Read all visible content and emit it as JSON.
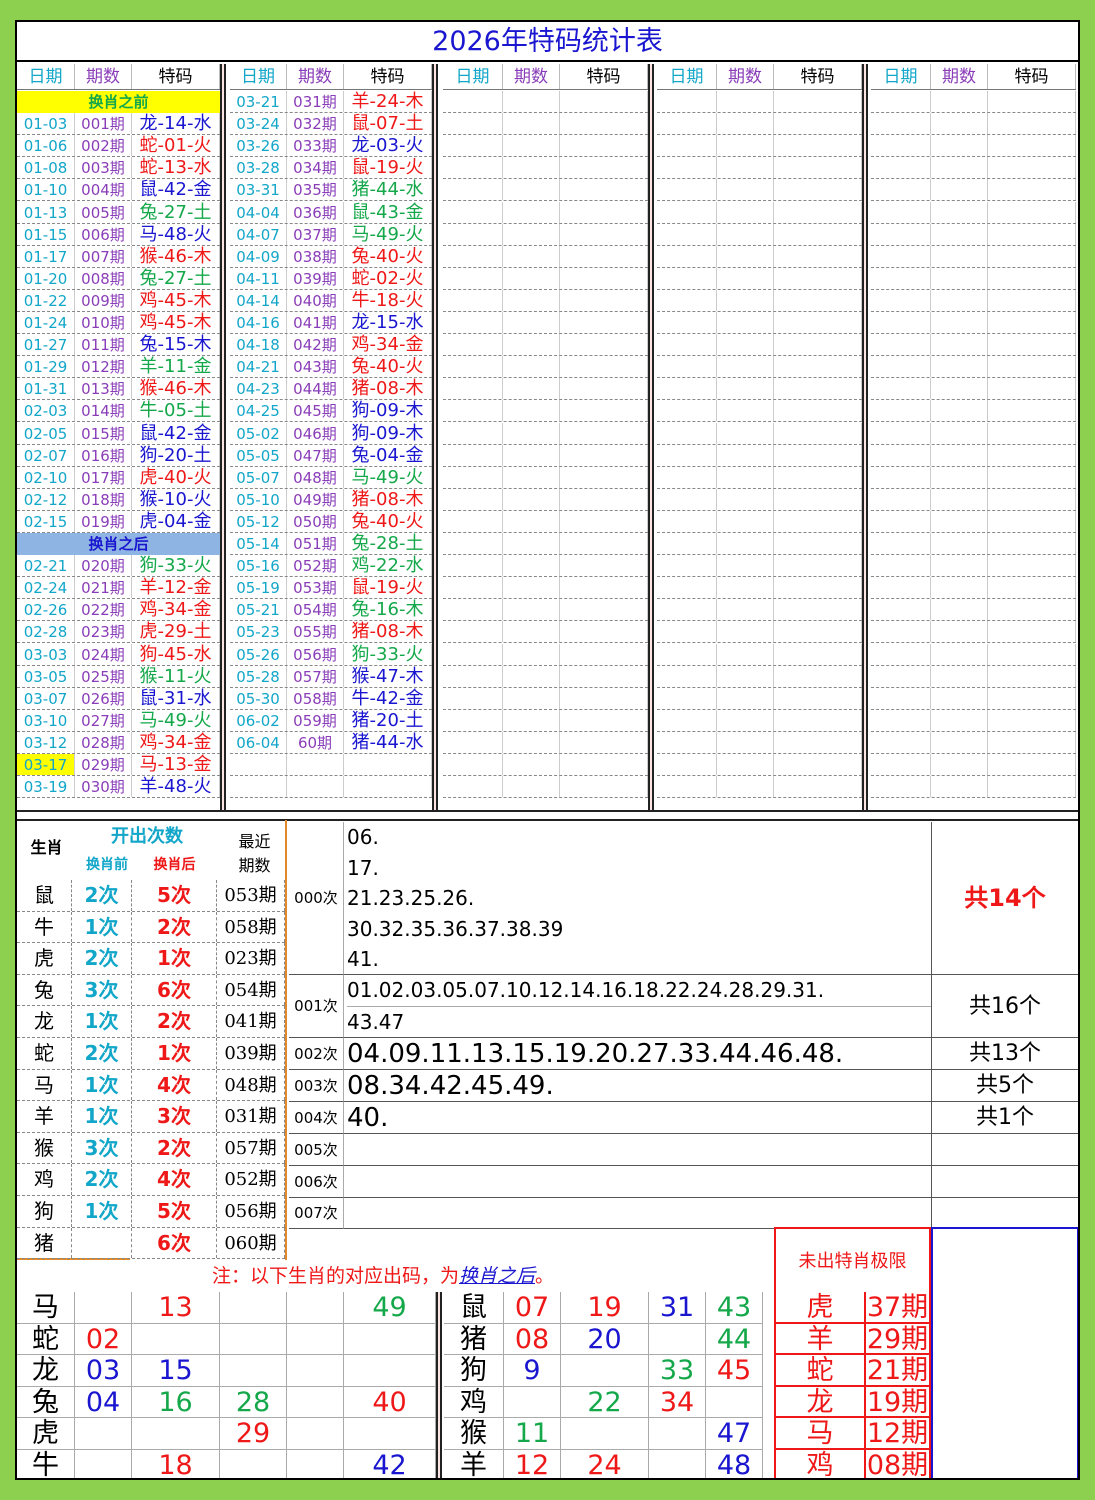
{
  "title": "2026年特码统计表",
  "headers": {
    "date": "日期",
    "issue": "期数",
    "code": "特码"
  },
  "colors": {
    "red": "#ef1818",
    "blue": "#1a16d0",
    "green": "#15a84a",
    "cyan": "#12a6c9",
    "purple": "#8a3db8",
    "yellow": "#ffff00",
    "lightblue": "#8db4e2"
  },
  "banner_before": "换肖之前",
  "banner_after": "换肖之后",
  "col1": [
    {
      "d": "01-03",
      "p": "001期",
      "c": "龙-14-水",
      "k": "blue"
    },
    {
      "d": "01-06",
      "p": "002期",
      "c": "蛇-01-火",
      "k": "red"
    },
    {
      "d": "01-08",
      "p": "003期",
      "c": "蛇-13-水",
      "k": "red"
    },
    {
      "d": "01-10",
      "p": "004期",
      "c": "鼠-42-金",
      "k": "blue"
    },
    {
      "d": "01-13",
      "p": "005期",
      "c": "兔-27-土",
      "k": "green"
    },
    {
      "d": "01-15",
      "p": "006期",
      "c": "马-48-火",
      "k": "blue"
    },
    {
      "d": "01-17",
      "p": "007期",
      "c": "猴-46-木",
      "k": "red"
    },
    {
      "d": "01-20",
      "p": "008期",
      "c": "兔-27-土",
      "k": "green"
    },
    {
      "d": "01-22",
      "p": "009期",
      "c": "鸡-45-木",
      "k": "red"
    },
    {
      "d": "01-24",
      "p": "010期",
      "c": "鸡-45-木",
      "k": "red"
    },
    {
      "d": "01-27",
      "p": "011期",
      "c": "兔-15-木",
      "k": "blue"
    },
    {
      "d": "01-29",
      "p": "012期",
      "c": "羊-11-金",
      "k": "green"
    },
    {
      "d": "01-31",
      "p": "013期",
      "c": "猴-46-木",
      "k": "red"
    },
    {
      "d": "02-03",
      "p": "014期",
      "c": "牛-05-土",
      "k": "green"
    },
    {
      "d": "02-05",
      "p": "015期",
      "c": "鼠-42-金",
      "k": "blue"
    },
    {
      "d": "02-07",
      "p": "016期",
      "c": "狗-20-土",
      "k": "blue"
    },
    {
      "d": "02-10",
      "p": "017期",
      "c": "虎-40-火",
      "k": "red"
    },
    {
      "d": "02-12",
      "p": "018期",
      "c": "猴-10-火",
      "k": "blue"
    },
    {
      "d": "02-15",
      "p": "019期",
      "c": "虎-04-金",
      "k": "blue"
    }
  ],
  "col1b": [
    {
      "d": "02-21",
      "p": "020期",
      "c": "狗-33-火",
      "k": "green"
    },
    {
      "d": "02-24",
      "p": "021期",
      "c": "羊-12-金",
      "k": "red"
    },
    {
      "d": "02-26",
      "p": "022期",
      "c": "鸡-34-金",
      "k": "red"
    },
    {
      "d": "02-28",
      "p": "023期",
      "c": "虎-29-土",
      "k": "red"
    },
    {
      "d": "03-03",
      "p": "024期",
      "c": "狗-45-水",
      "k": "red"
    },
    {
      "d": "03-05",
      "p": "025期",
      "c": "猴-11-火",
      "k": "green"
    },
    {
      "d": "03-07",
      "p": "026期",
      "c": "鼠-31-水",
      "k": "blue"
    },
    {
      "d": "03-10",
      "p": "027期",
      "c": "马-49-火",
      "k": "green"
    },
    {
      "d": "03-12",
      "p": "028期",
      "c": "鸡-34-金",
      "k": "red"
    },
    {
      "d": "03-17",
      "p": "029期",
      "c": "马-13-金",
      "k": "red",
      "hl": true
    },
    {
      "d": "03-19",
      "p": "030期",
      "c": "羊-48-火",
      "k": "blue"
    }
  ],
  "col2": [
    {
      "d": "03-21",
      "p": "031期",
      "c": "羊-24-木",
      "k": "red"
    },
    {
      "d": "03-24",
      "p": "032期",
      "c": "鼠-07-土",
      "k": "red"
    },
    {
      "d": "03-26",
      "p": "033期",
      "c": "龙-03-火",
      "k": "blue"
    },
    {
      "d": "03-28",
      "p": "034期",
      "c": "鼠-19-火",
      "k": "red"
    },
    {
      "d": "03-31",
      "p": "035期",
      "c": "猪-44-水",
      "k": "green"
    },
    {
      "d": "04-04",
      "p": "036期",
      "c": "鼠-43-金",
      "k": "green"
    },
    {
      "d": "04-07",
      "p": "037期",
      "c": "马-49-火",
      "k": "green"
    },
    {
      "d": "04-09",
      "p": "038期",
      "c": "兔-40-火",
      "k": "red"
    },
    {
      "d": "04-11",
      "p": "039期",
      "c": "蛇-02-火",
      "k": "red"
    },
    {
      "d": "04-14",
      "p": "040期",
      "c": "牛-18-火",
      "k": "red"
    },
    {
      "d": "04-16",
      "p": "041期",
      "c": "龙-15-水",
      "k": "blue"
    },
    {
      "d": "04-18",
      "p": "042期",
      "c": "鸡-34-金",
      "k": "red"
    },
    {
      "d": "04-21",
      "p": "043期",
      "c": "兔-40-火",
      "k": "red"
    },
    {
      "d": "04-23",
      "p": "044期",
      "c": "猪-08-木",
      "k": "red"
    },
    {
      "d": "04-25",
      "p": "045期",
      "c": "狗-09-木",
      "k": "blue"
    },
    {
      "d": "05-02",
      "p": "046期",
      "c": "狗-09-木",
      "k": "blue"
    },
    {
      "d": "05-05",
      "p": "047期",
      "c": "兔-04-金",
      "k": "blue"
    },
    {
      "d": "05-07",
      "p": "048期",
      "c": "马-49-火",
      "k": "green"
    },
    {
      "d": "05-10",
      "p": "049期",
      "c": "猪-08-木",
      "k": "red"
    },
    {
      "d": "05-12",
      "p": "050期",
      "c": "兔-40-火",
      "k": "red"
    },
    {
      "d": "05-14",
      "p": "051期",
      "c": "兔-28-土",
      "k": "green"
    },
    {
      "d": "05-16",
      "p": "052期",
      "c": "鸡-22-水",
      "k": "green"
    },
    {
      "d": "05-19",
      "p": "053期",
      "c": "鼠-19-火",
      "k": "red"
    },
    {
      "d": "05-21",
      "p": "054期",
      "c": "兔-16-木",
      "k": "green"
    },
    {
      "d": "05-23",
      "p": "055期",
      "c": "猪-08-木",
      "k": "red"
    },
    {
      "d": "05-26",
      "p": "056期",
      "c": "狗-33-火",
      "k": "green"
    },
    {
      "d": "05-28",
      "p": "057期",
      "c": "猴-47-木",
      "k": "blue"
    },
    {
      "d": "05-30",
      "p": "058期",
      "c": "牛-42-金",
      "k": "blue"
    },
    {
      "d": "06-02",
      "p": "059期",
      "c": "猪-20-土",
      "k": "blue"
    },
    {
      "d": "06-04",
      "p": "60期",
      "c": "猪-44-水",
      "k": "blue"
    }
  ],
  "stats": {
    "h_zodiac": "生肖",
    "h_count": "开出次数",
    "h_before": "换肖前",
    "h_after": "换肖后",
    "h_recent1": "最近",
    "h_recent2": "期数",
    "rows": [
      {
        "z": "鼠",
        "b": "2次",
        "a": "5次",
        "r": "053期"
      },
      {
        "z": "牛",
        "b": "1次",
        "a": "2次",
        "r": "058期"
      },
      {
        "z": "虎",
        "b": "2次",
        "a": "1次",
        "r": "023期"
      },
      {
        "z": "兔",
        "b": "3次",
        "a": "6次",
        "r": "054期"
      },
      {
        "z": "龙",
        "b": "1次",
        "a": "2次",
        "r": "041期"
      },
      {
        "z": "蛇",
        "b": "2次",
        "a": "1次",
        "r": "039期"
      },
      {
        "z": "马",
        "b": "1次",
        "a": "4次",
        "r": "048期"
      },
      {
        "z": "羊",
        "b": "1次",
        "a": "3次",
        "r": "031期"
      },
      {
        "z": "猴",
        "b": "3次",
        "a": "2次",
        "r": "057期"
      },
      {
        "z": "鸡",
        "b": "2次",
        "a": "4次",
        "r": "052期"
      },
      {
        "z": "狗",
        "b": "1次",
        "a": "5次",
        "r": "056期"
      },
      {
        "z": "猪",
        "b": "",
        "a": "6次",
        "r": "060期"
      }
    ]
  },
  "groups": {
    "g0": {
      "label": "000次",
      "lines": [
        "06.",
        "17.",
        "21.23.25.26.",
        "30.32.35.36.37.38.39",
        "41."
      ],
      "total": "共14个"
    },
    "g1": {
      "label": "001次",
      "lines": [
        "01.02.03.05.07.10.12.14.16.18.22.24.28.29.31.",
        "43.47"
      ],
      "total": "共16个"
    },
    "g2": {
      "label": "002次",
      "text": "04.09.11.13.15.19.20.27.33.44.46.48.",
      "total": "共13个"
    },
    "g3": {
      "label": "003次",
      "text": "08.34.42.45.49.",
      "total": "共5个"
    },
    "g4": {
      "label": "004次",
      "text": "40.",
      "total": "共1个"
    },
    "g5": {
      "label": "005次"
    },
    "g6": {
      "label": "006次"
    },
    "g7": {
      "label": "007次"
    }
  },
  "note": {
    "prefix": "注：以下生肖的对应出码，为",
    "link": "换肖之后",
    "suffix": "。"
  },
  "limit_title": "未出特肖极限",
  "bottom_left": [
    {
      "z": "马",
      "n": [
        [
          "",
          ""
        ],
        [
          "13",
          "red"
        ],
        [
          "",
          ""
        ],
        [
          "",
          ""
        ],
        [
          "49",
          "green"
        ]
      ]
    },
    {
      "z": "蛇",
      "n": [
        [
          "02",
          "red"
        ],
        [
          "",
          ""
        ],
        [
          "",
          ""
        ],
        [
          "",
          ""
        ],
        [
          "",
          ""
        ]
      ]
    },
    {
      "z": "龙",
      "n": [
        [
          "03",
          "blue"
        ],
        [
          "15",
          "blue"
        ],
        [
          "",
          ""
        ],
        [
          "",
          ""
        ],
        [
          "",
          ""
        ]
      ]
    },
    {
      "z": "兔",
      "n": [
        [
          "04",
          "blue"
        ],
        [
          "16",
          "green"
        ],
        [
          "28",
          "green"
        ],
        [
          "",
          ""
        ],
        [
          "40",
          "red"
        ]
      ]
    },
    {
      "z": "虎",
      "n": [
        [
          "",
          ""
        ],
        [
          "",
          ""
        ],
        [
          "29",
          "red"
        ],
        [
          "",
          ""
        ],
        [
          "",
          ""
        ]
      ]
    },
    {
      "z": "牛",
      "n": [
        [
          "",
          ""
        ],
        [
          "18",
          "red"
        ],
        [
          "",
          ""
        ],
        [
          "",
          ""
        ],
        [
          "42",
          "blue"
        ]
      ]
    }
  ],
  "bottom_right": [
    {
      "z": "鼠",
      "n": [
        [
          "07",
          "red"
        ],
        [
          "19",
          "red"
        ],
        [
          "31",
          "blue"
        ],
        [
          "43",
          "green"
        ]
      ]
    },
    {
      "z": "猪",
      "n": [
        [
          "08",
          "red"
        ],
        [
          "20",
          "blue"
        ],
        [
          "",
          ""
        ],
        [
          "44",
          "green"
        ]
      ]
    },
    {
      "z": "狗",
      "n": [
        [
          "9",
          "blue"
        ],
        [
          "",
          ""
        ],
        [
          "33",
          "green"
        ],
        [
          "45",
          "red"
        ]
      ]
    },
    {
      "z": "鸡",
      "n": [
        [
          "",
          ""
        ],
        [
          "22",
          "green"
        ],
        [
          "34",
          "red"
        ],
        [
          "",
          ""
        ]
      ]
    },
    {
      "z": "猴",
      "n": [
        [
          "11",
          "green"
        ],
        [
          "",
          ""
        ],
        [
          "",
          ""
        ],
        [
          "47",
          "blue"
        ]
      ]
    },
    {
      "z": "羊",
      "n": [
        [
          "12",
          "red"
        ],
        [
          "24",
          "red"
        ],
        [
          "",
          ""
        ],
        [
          "48",
          "blue"
        ]
      ]
    }
  ],
  "limits": [
    {
      "z": "虎",
      "p": "37期"
    },
    {
      "z": "羊",
      "p": "29期"
    },
    {
      "z": "蛇",
      "p": "21期"
    },
    {
      "z": "龙",
      "p": "19期"
    },
    {
      "z": "马",
      "p": "12期"
    },
    {
      "z": "鸡",
      "p": "08期"
    }
  ]
}
